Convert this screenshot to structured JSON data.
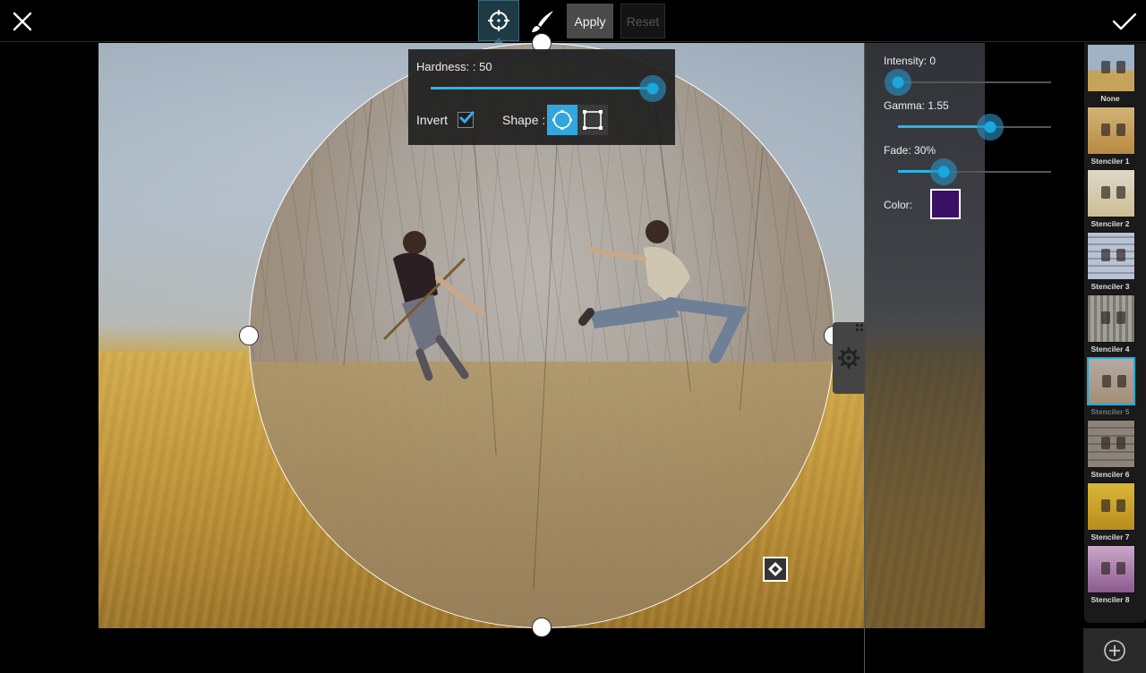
{
  "toolbar": {
    "apply_label": "Apply",
    "reset_label": "Reset",
    "close_icon": "close-icon",
    "confirm_icon": "checkmark-icon",
    "selection_tool_icon": "selection-crosshair-icon",
    "brush_tool_icon": "brush-icon"
  },
  "hardness": {
    "label": "Hardness: : 50",
    "value": 50,
    "invert_label": "Invert",
    "invert_checked": true,
    "shape_label": "Shape :",
    "shape_selected": "circle"
  },
  "adjustments": {
    "intensity_label": "Intensity: 0",
    "intensity_value_fraction": 0.0,
    "gamma_label": "Gamma: 1.55",
    "gamma_value_fraction": 0.6,
    "fade_label": "Fade: 30%",
    "fade_value_fraction": 0.3,
    "color_label": "Color:",
    "color_value": "#3a1066"
  },
  "accent_color": "#2fb2e6",
  "stencils": [
    {
      "label": "None",
      "selected": false
    },
    {
      "label": "Stenciler 1",
      "selected": false
    },
    {
      "label": "Stenciler 2",
      "selected": false
    },
    {
      "label": "Stenciler 3",
      "selected": false
    },
    {
      "label": "Stenciler 4",
      "selected": false
    },
    {
      "label": "Stenciler 5",
      "selected": true
    },
    {
      "label": "Stenciler 6",
      "selected": false
    },
    {
      "label": "Stenciler 7",
      "selected": false
    },
    {
      "label": "Stenciler 8",
      "selected": false
    }
  ]
}
